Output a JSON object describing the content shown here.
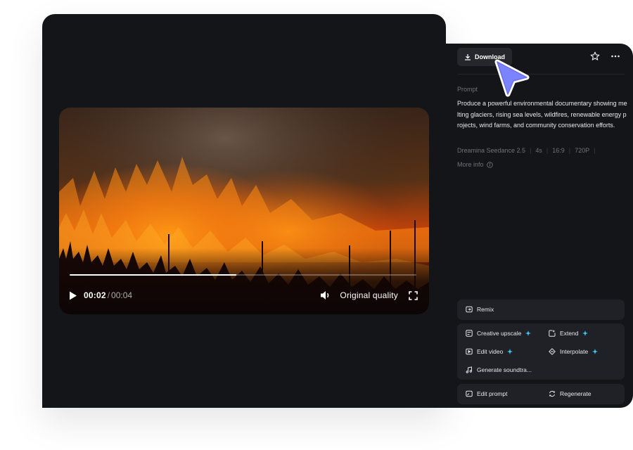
{
  "video": {
    "time_current": "00:02",
    "time_separator": "/",
    "time_total": "00:04",
    "progress": 0.48,
    "quality": "Original quality"
  },
  "panel": {
    "download_label": "Download",
    "prompt_label": "Prompt",
    "prompt_text": "Produce a powerful environmental documentary showing melting glaciers, rising sea levels, wildfires, renewable energy projects, wind farms, and community conservation efforts.",
    "meta": {
      "model": "Dreamina Seedance 2.5",
      "duration": "4s",
      "ratio": "16:9",
      "resolution": "720P"
    },
    "more_info": "More info"
  },
  "actions": {
    "remix": "Remix",
    "creative_upscale": "Creative upscale",
    "extend": "Extend",
    "edit_video": "Edit video",
    "interpolate": "Interpolate",
    "generate_soundtrack": "Generate soundtra...",
    "edit_prompt": "Edit prompt",
    "regenerate": "Regenerate"
  },
  "colors": {
    "panel_bg": "#141518",
    "card_bg": "#202126",
    "sparkle": "#3ed2ff",
    "cursor": "#7c83ff"
  }
}
